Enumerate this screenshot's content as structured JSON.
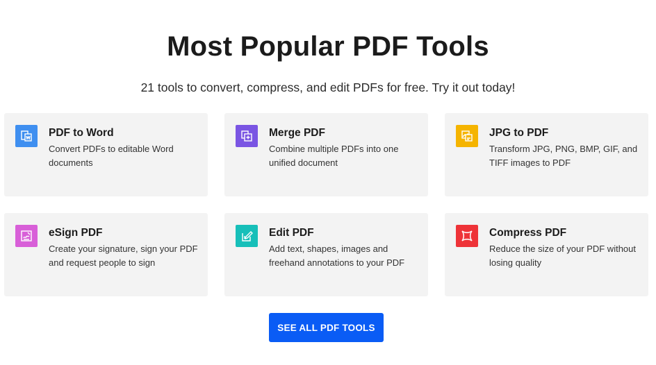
{
  "header": {
    "title": "Most Popular PDF Tools",
    "subtitle": "21 tools to convert, compress, and edit PDFs for free. Try it out today!"
  },
  "tools": [
    {
      "name": "PDF to Word",
      "description": "Convert PDFs to editable Word documents",
      "icon": "pdf-to-word-icon",
      "color": "#3f8ff0"
    },
    {
      "name": "Merge PDF",
      "description": "Combine multiple PDFs into one unified document",
      "icon": "merge-pdf-icon",
      "color": "#7a55e3"
    },
    {
      "name": "JPG to PDF",
      "description": "Transform JPG, PNG, BMP, GIF, and TIFF images to PDF",
      "icon": "jpg-to-pdf-icon",
      "color": "#f5b400"
    },
    {
      "name": "eSign PDF",
      "description": "Create your signature, sign your PDF and request people to sign",
      "icon": "esign-pdf-icon",
      "color": "#d85fd8"
    },
    {
      "name": "Edit PDF",
      "description": "Add text, shapes, images and freehand annotations to your PDF",
      "icon": "edit-pdf-icon",
      "color": "#17bfb9"
    },
    {
      "name": "Compress PDF",
      "description": "Reduce the size of your PDF without losing quality",
      "icon": "compress-pdf-icon",
      "color": "#ee3338"
    }
  ],
  "cta": {
    "label": "SEE ALL PDF TOOLS",
    "color": "#0a5cf5"
  }
}
